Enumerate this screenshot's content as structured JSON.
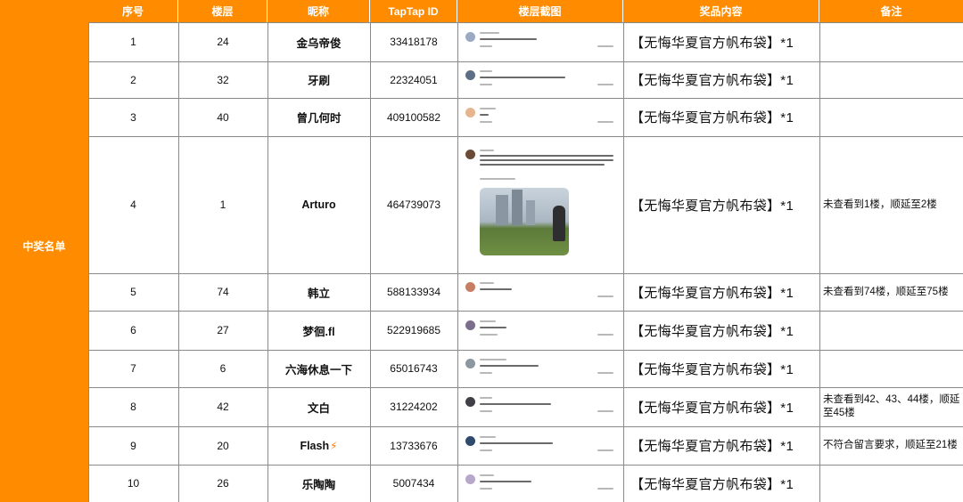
{
  "side_label": "中奖名单",
  "headers": [
    "序号",
    "楼层",
    "昵称",
    "TapTap ID",
    "楼层截图",
    "奖品内容",
    "备注"
  ],
  "rows": [
    {
      "no": "1",
      "floor": "24",
      "nick": "金乌帝俊",
      "id": "33418178",
      "prize": "【无悔华夏官方帆布袋】*1",
      "note": ""
    },
    {
      "no": "2",
      "floor": "32",
      "nick": "牙刷",
      "id": "22324051",
      "prize": "【无悔华夏官方帆布袋】*1",
      "note": ""
    },
    {
      "no": "3",
      "floor": "40",
      "nick": "曾几何时",
      "id": "409100582",
      "prize": "【无悔华夏官方帆布袋】*1",
      "note": ""
    },
    {
      "no": "4",
      "floor": "1",
      "nick": "Arturo",
      "id": "464739073",
      "prize": "【无悔华夏官方帆布袋】*1",
      "note": "未查看到1楼，顺延至2楼"
    },
    {
      "no": "5",
      "floor": "74",
      "nick": "韩立",
      "id": "588133934",
      "prize": "【无悔华夏官方帆布袋】*1",
      "note": "未查看到74楼，顺延至75楼"
    },
    {
      "no": "6",
      "floor": "27",
      "nick": "梦徊.fl",
      "id": "522919685",
      "prize": "【无悔华夏官方帆布袋】*1",
      "note": ""
    },
    {
      "no": "7",
      "floor": "6",
      "nick": "六海休息一下",
      "id": "65016743",
      "prize": "【无悔华夏官方帆布袋】*1",
      "note": ""
    },
    {
      "no": "8",
      "floor": "42",
      "nick": "文白",
      "id": "31224202",
      "prize": "【无悔华夏官方帆布袋】*1",
      "note": "未查看到42、43、44楼，顺延至45楼"
    },
    {
      "no": "9",
      "floor": "20",
      "nick": "Flash",
      "id": "13733676",
      "prize": "【无悔华夏官方帆布袋】*1",
      "note": "不符合留言要求，顺延至21楼"
    },
    {
      "no": "10",
      "floor": "26",
      "nick": "乐陶陶",
      "id": "5007434",
      "prize": "【无悔华夏官方帆布袋】*1",
      "note": ""
    }
  ],
  "icons": {
    "lightning": "lightning-bolt-icon"
  },
  "colors": {
    "accent": "#ff8c00",
    "grid": "#8a8a8a"
  }
}
